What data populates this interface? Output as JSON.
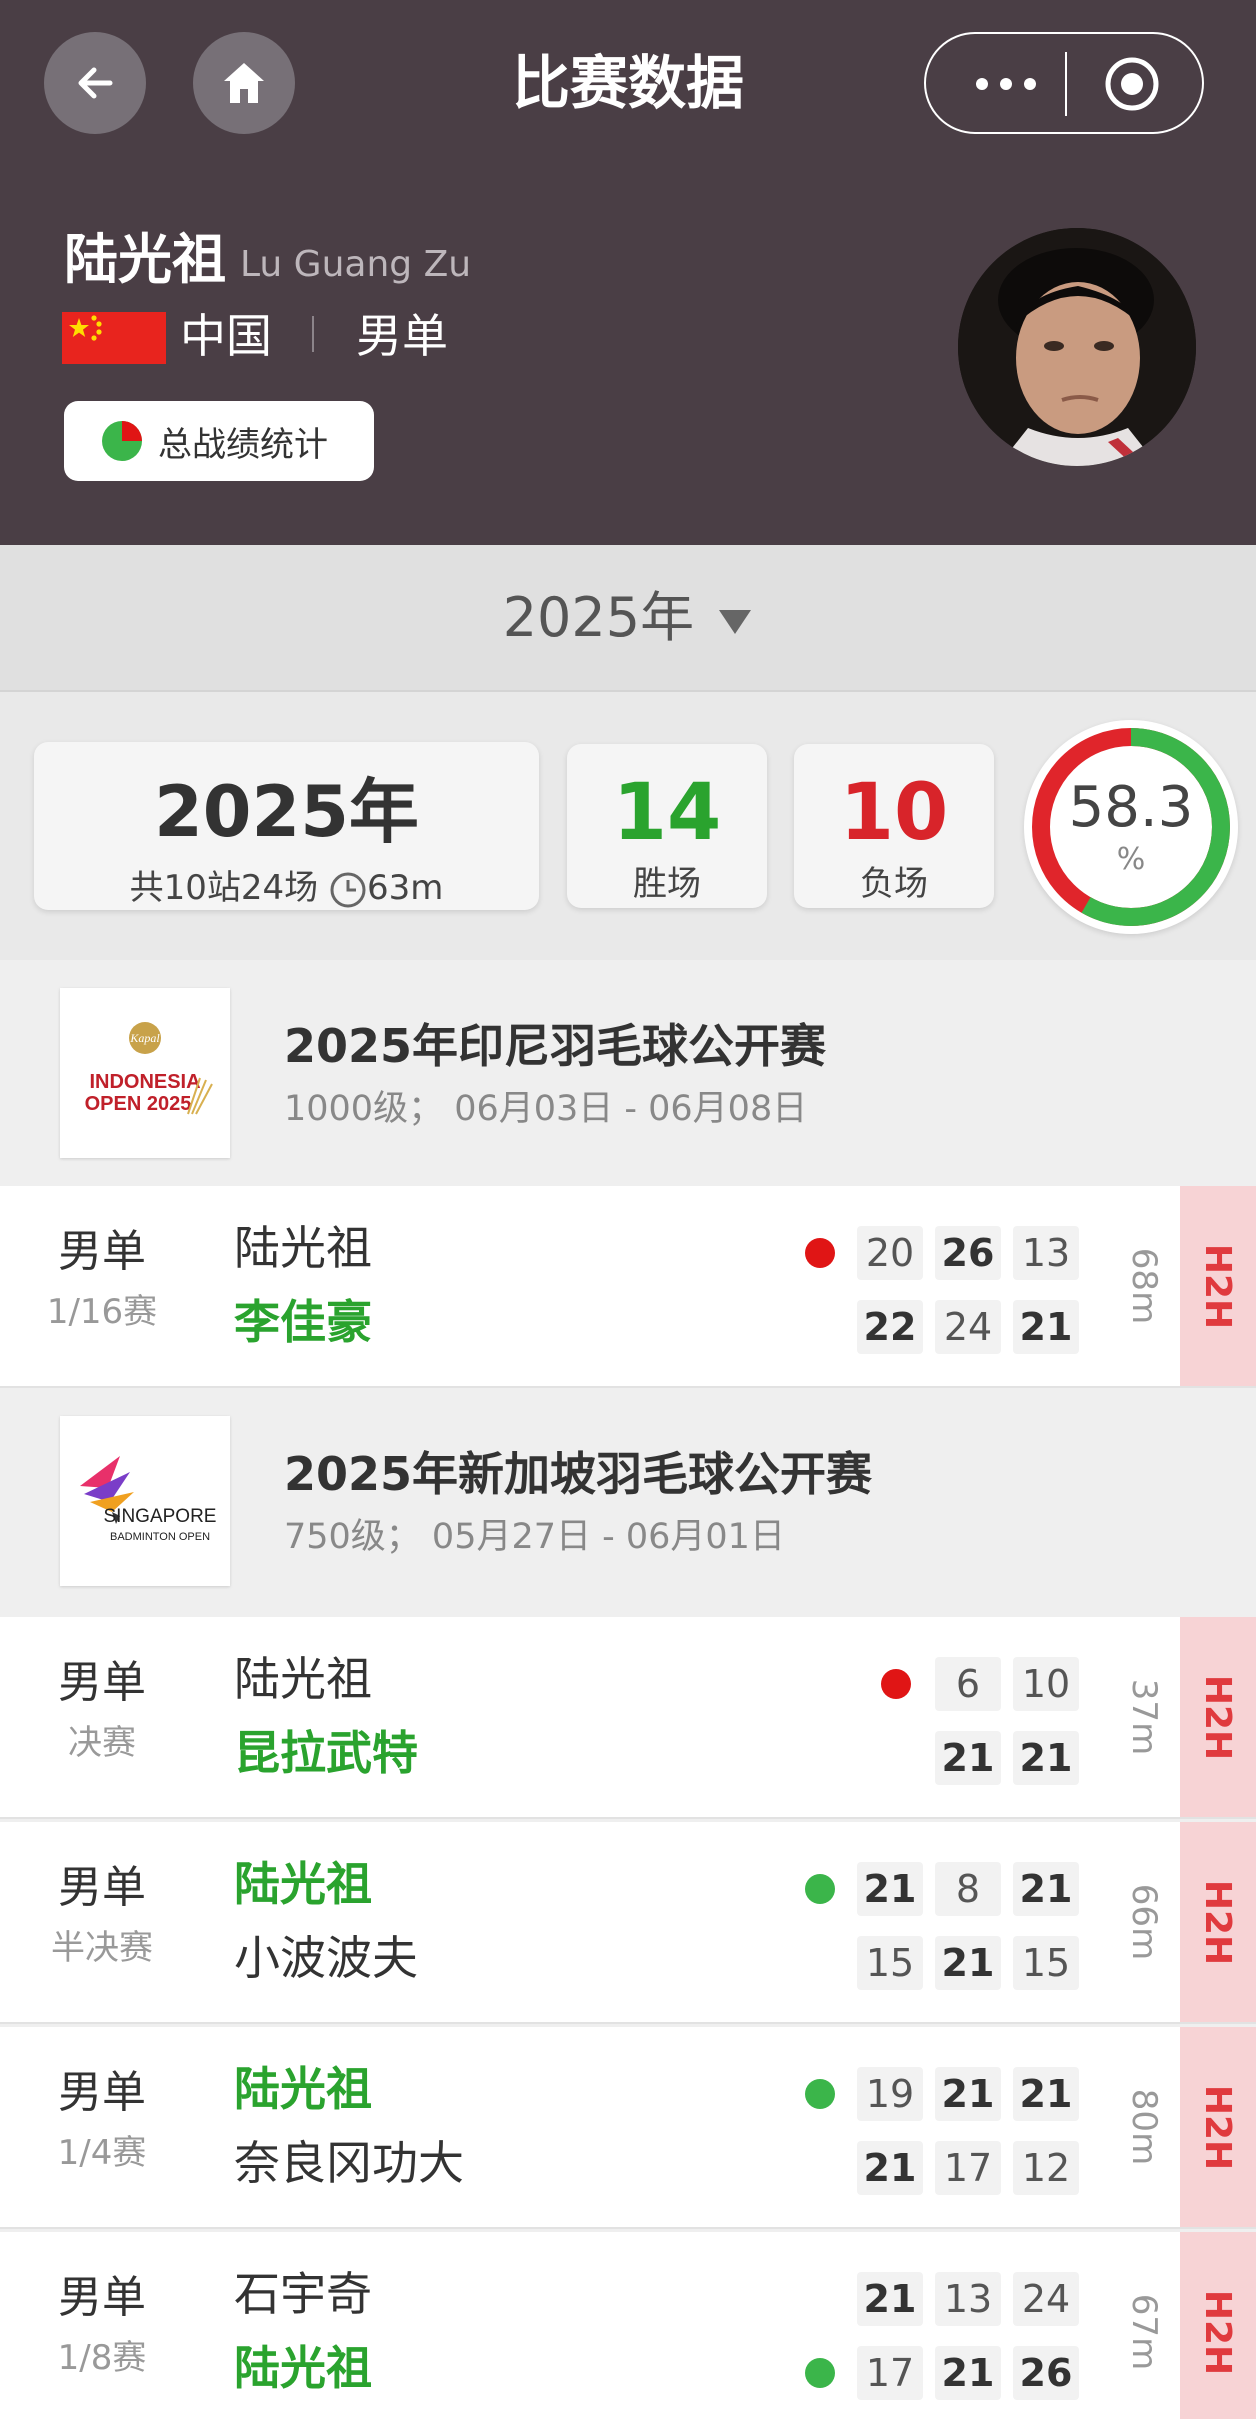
{
  "header": {
    "title": "比赛数据",
    "back_icon": "back-arrow-icon",
    "home_icon": "home-icon",
    "more_icon": "more-dots-icon",
    "close_icon": "target-circle-icon"
  },
  "player": {
    "name": "陆光祖",
    "name_en": "Lu Guang Zu",
    "country": "中国",
    "event": "男单",
    "stats_button": "总战绩统计"
  },
  "year_selector": {
    "label": "2025年"
  },
  "summary": {
    "year": "2025年",
    "detail": "共10站24场",
    "avg_time": "63m",
    "wins": "14",
    "wins_label": "胜场",
    "losses": "10",
    "losses_label": "负场",
    "win_rate": "58.3",
    "win_rate_unit": "%",
    "win_rate_value": 58.3
  },
  "colors": {
    "win": "#2aa32e",
    "loss": "#e01515",
    "header_bg": "#4a3e45",
    "h2h_bg": "#f7d3d5"
  },
  "tournaments": [
    {
      "name": "2025年印尼羽毛球公开赛",
      "info": "1000级； 06月03日 - 06月08日",
      "logo_text": "INDONESIA OPEN 2025",
      "matches": [
        {
          "category": "男单",
          "round": "1/16赛",
          "player1": "陆光祖",
          "player2": "李佳豪",
          "winner": 2,
          "result": "loss",
          "scores1": [
            "20",
            "26",
            "13"
          ],
          "scores2": [
            "22",
            "24",
            "21"
          ],
          "duration": "68m",
          "h2h": "H2H"
        }
      ]
    },
    {
      "name": "2025年新加坡羽毛球公开赛",
      "info": "750级； 05月27日 - 06月01日",
      "logo_text": "SINGAPORE BADMINTON OPEN",
      "matches": [
        {
          "category": "男单",
          "round": "决赛",
          "player1": "陆光祖",
          "player2": "昆拉武特",
          "winner": 2,
          "result": "loss",
          "scores1": [
            "6",
            "10"
          ],
          "scores2": [
            "21",
            "21"
          ],
          "duration": "37m",
          "h2h": "H2H"
        },
        {
          "category": "男单",
          "round": "半决赛",
          "player1": "陆光祖",
          "player2": "小波波夫",
          "winner": 1,
          "result": "win",
          "scores1": [
            "21",
            "8",
            "21"
          ],
          "scores2": [
            "15",
            "21",
            "15"
          ],
          "duration": "66m",
          "h2h": "H2H"
        },
        {
          "category": "男单",
          "round": "1/4赛",
          "player1": "陆光祖",
          "player2": "奈良冈功大",
          "winner": 1,
          "result": "win",
          "scores1": [
            "19",
            "21",
            "21"
          ],
          "scores2": [
            "21",
            "17",
            "12"
          ],
          "duration": "80m",
          "h2h": "H2H"
        },
        {
          "category": "男单",
          "round": "1/8赛",
          "player1": "石宇奇",
          "player2": "陆光祖",
          "winner": 2,
          "result": "win",
          "scores1": [
            "21",
            "13",
            "24"
          ],
          "scores2": [
            "17",
            "21",
            "26"
          ],
          "duration": "67m",
          "h2h": "H2H"
        }
      ]
    }
  ]
}
